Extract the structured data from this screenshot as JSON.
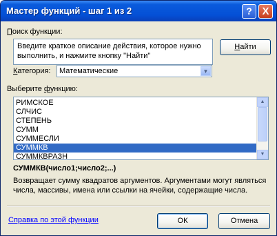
{
  "window": {
    "title": "Мастер функций - шаг 1 из 2",
    "help_glyph": "?",
    "close_glyph": "X"
  },
  "search": {
    "label": "Поиск функции:",
    "description": "Введите краткое описание действия, которое нужно выполнить, и нажмите кнопку \"Найти\"",
    "find_button": "Найти"
  },
  "category": {
    "label": "Категория:",
    "value": "Математические"
  },
  "functions": {
    "label": "Выберите функцию:",
    "items": [
      "РИМСКОЕ",
      "СЛЧИС",
      "СТЕПЕНЬ",
      "СУММ",
      "СУММЕСЛИ",
      "СУММКВ",
      "СУММКВРАЗН"
    ],
    "selected": "СУММКВ"
  },
  "details": {
    "syntax": "СУММКВ(число1;число2;...)",
    "description": "Возвращает сумму квадратов аргументов. Аргументами могут являться числа, массивы, имена или ссылки на ячейки, содержащие числа."
  },
  "footer": {
    "help_link": "Справка по этой функции",
    "ok_button": "ОК",
    "cancel_button": "Отмена"
  },
  "colors": {
    "titlebar": "#0450d6",
    "selection": "#316ac5",
    "dialog_bg": "#ece9d8",
    "link": "#0000ff"
  }
}
